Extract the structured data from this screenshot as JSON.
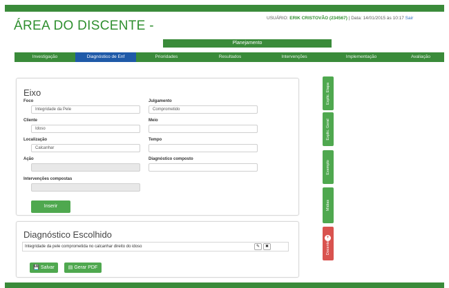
{
  "header": {
    "title": "ÁREA DO DISCENTE -",
    "user_prefix": "USUÁRIO:",
    "user_name": "ERIK CRISTOVÃO (234567)",
    "date_text": "| Data: 14/01/2015 às 10:17",
    "logout": "Sair"
  },
  "stage": "Planejamento",
  "nav": {
    "tabs": [
      {
        "label": "Investigação",
        "active": false
      },
      {
        "label": "Diagnóstico de Enf",
        "active": true
      },
      {
        "label": "Prioridades",
        "active": false
      },
      {
        "label": "Resultados",
        "active": false
      },
      {
        "label": "Intervenções",
        "active": false
      },
      {
        "label": "Implementação",
        "active": false
      },
      {
        "label": "Avaliação",
        "active": false
      }
    ]
  },
  "eixo": {
    "heading": "Eixo",
    "foco": {
      "label": "Foco",
      "value": "Integridade da Pele"
    },
    "julgamento": {
      "label": "Julgamento",
      "value": "Comprometido"
    },
    "cliente": {
      "label": "Cliente",
      "value": "Idoso"
    },
    "meio": {
      "label": "Meio",
      "value": ""
    },
    "localizacao": {
      "label": "Localização",
      "value": "Calcanhar"
    },
    "tempo": {
      "label": "Tempo",
      "value": ""
    },
    "acao": {
      "label": "Ação",
      "value": ""
    },
    "diagnostico_composto": {
      "label": "Diagnóstico composto",
      "value": ""
    },
    "intervencoes_compostas": {
      "label": "Intervenções compostas",
      "value": ""
    },
    "insert_button": "Inserir"
  },
  "diagnostico": {
    "heading": "Diagnóstico Escolhido",
    "row": "Integridade da pele comprometida no calcanhar direito do idoso",
    "edit_icon": "✎",
    "delete_icon": "✖",
    "save_icon": "💾",
    "save_button": "Salvar",
    "pdf_icon": "▤",
    "pdf_button": "Gerar PDF"
  },
  "side_tabs": {
    "explic_etapa": "Explic. Etapa",
    "explic_geral": "Explic. Geral",
    "exemplo": "Exemplo",
    "midias": "Mídias",
    "docente": "Docente",
    "docente_badge": "+"
  },
  "colors": {
    "brand_green": "#3a8b3a",
    "active_blue": "#1f5aa8",
    "button_green": "#4fa84f",
    "docente_red": "#d9534f"
  }
}
